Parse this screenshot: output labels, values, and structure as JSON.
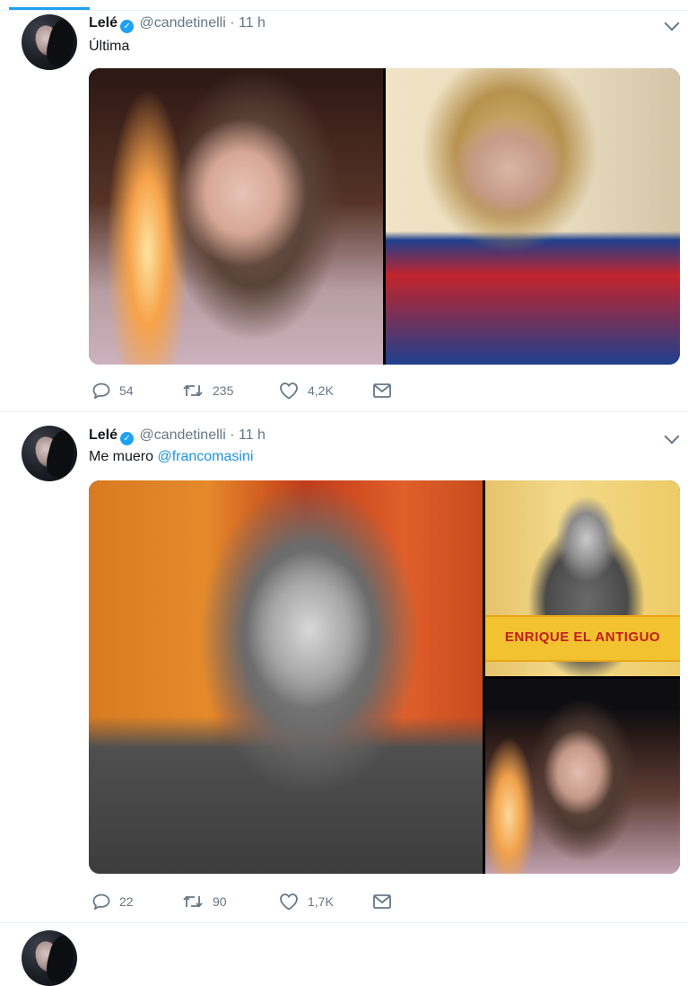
{
  "tweets": [
    {
      "name": "Lelé",
      "handle": "@candetinelli",
      "separator": "·",
      "time": "11 h",
      "text": "Última",
      "mention": "",
      "replies": "54",
      "retweets": "235",
      "likes": "4,2K"
    },
    {
      "name": "Lelé",
      "handle": "@candetinelli",
      "separator": "·",
      "time": "11 h",
      "text": "Me muero ",
      "mention": "@francomasini",
      "replies": "22",
      "retweets": "90",
      "likes": "1,7K",
      "banner_text": "ENRIQUE EL ANTIGUO"
    }
  ],
  "colors": {
    "accent": "#1da1f2",
    "link": "#1b95e0",
    "muted": "#657786",
    "divider": "#e6ecf0"
  },
  "icons": [
    "reply-icon",
    "retweet-icon",
    "like-icon",
    "dm-icon",
    "verified-badge-icon",
    "chevron-down-icon"
  ]
}
